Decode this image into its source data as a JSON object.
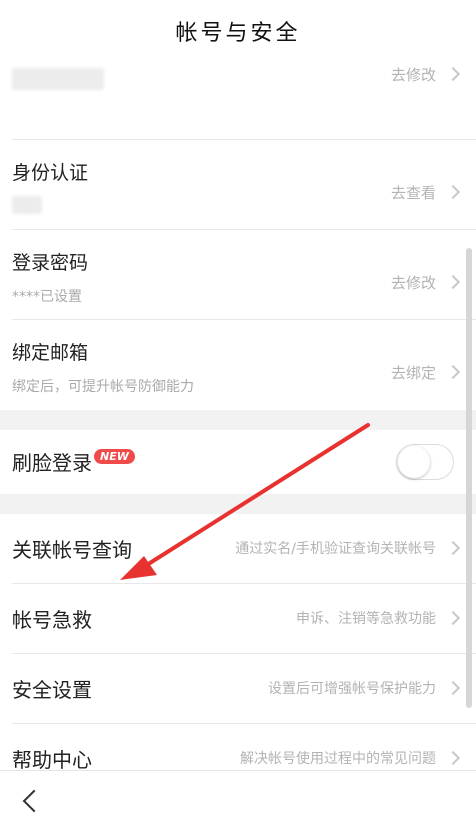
{
  "header": {
    "title": "帐号与安全"
  },
  "sections": {
    "account": [
      {
        "main": "",
        "sub": "",
        "action": "去修改"
      },
      {
        "main": "身份认证",
        "sub": "",
        "action": "去查看"
      },
      {
        "main": "登录密码",
        "sub": "****已设置",
        "action": "去修改"
      },
      {
        "main": "绑定邮箱",
        "sub": "绑定后，可提升帐号防御能力",
        "action": "去绑定"
      }
    ],
    "face_login": {
      "label": "刷脸登录",
      "badge": "NEW",
      "enabled": false
    },
    "tools": [
      {
        "main": "关联帐号查询",
        "action": "通过实名/手机验证查询关联帐号"
      },
      {
        "main": "帐号急救",
        "action": "申诉、注销等急救功能"
      },
      {
        "main": "安全设置",
        "action": "设置后可增强帐号保护能力"
      },
      {
        "main": "帮助中心",
        "action": "解决帐号使用过程中的常见问题"
      }
    ]
  },
  "annotation": {
    "arrow_color": "#e8322f"
  },
  "icons": {
    "back": "back-chevron-icon",
    "chevron": "chevron-right-icon"
  }
}
